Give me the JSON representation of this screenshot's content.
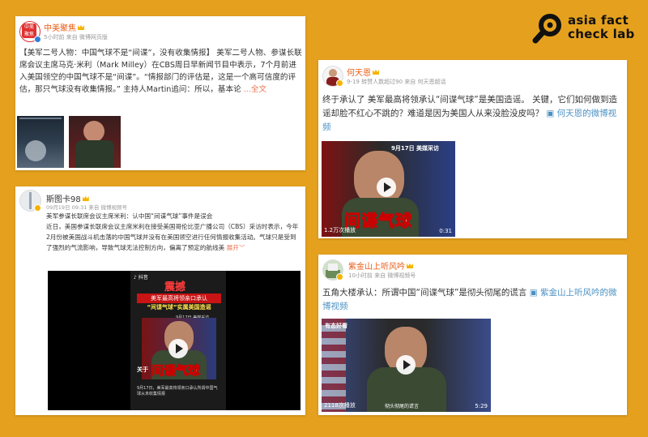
{
  "brand": {
    "line1": "asia fact",
    "line2": "check lab"
  },
  "posts": [
    {
      "username": "中美聚焦",
      "avatar_text": "聚中|焦美",
      "meta": "5小时前 来自 微博网页版",
      "text": "【美军二号人物：中国气球不是“间谍”，没有收集情报】 美军二号人物、参谋长联席会议主席马克·米利（Mark Milley）在CBS周日早新闻节目中表示，7个月前进入美国领空的中国气球不是“间谍”。“情报部门的评估是，这是一个高可信度的评估，那只气球没有收集情报。” 主持人Martin追问：所以，基本论",
      "more_label": "...全文"
    },
    {
      "username": "何天恩",
      "meta": "9-19 转赞人数超过90 来自 何天恩超话",
      "text": "终于承认了 美军最高将领承认“间谍气球”是美国造谣。 关键，它们如何做到造谣却脸不红心不跳的？难道是因为美国人从来没脸没皮吗？",
      "video_link": "何天恩的微博视频",
      "video": {
        "top_caption": "9月17日 美媒采访",
        "big_caption": "间谍气球",
        "views": "1.2万次播放",
        "duration": "0:31"
      }
    },
    {
      "username": "斯图卡98",
      "meta": "09月19日 09:31 来自 微博视频号",
      "text": "美军参谋长联席会议主席米利：认中国“间谍气球”事件是误会\n近日，美国参谋长联席会议主席米利在接受美国哥伦比亚广播公司（CBS）采访时表示，今年2月份被美国战斗机击落的中国气球并没有在美国领空进行任何情报收集活动。气球只是受到了强烈的气流影响，导致气球无法控制方向，偏离了预定的航线美",
      "expand_label": "展开",
      "video": {
        "app_name": "抖音",
        "headline": "震撼",
        "sub1": "美军最高将领亲口承认",
        "sub2": "“间谍气球”实属美国造谣",
        "date_tag": "9月17日 美媒采访",
        "side_text": "关于",
        "big_caption": "间谍气球",
        "bottom_text": "9月17日，美军最高将领亲口承认所谓中国气球从未收集情报"
      }
    },
    {
      "username": "紫金山上听风吟",
      "meta": "10小时前 来自 微博视频号",
      "text": "五角大楼承认：所谓中国“间谍气球”是彻头彻尾的谎言",
      "video_link": "紫金山上听风吟的微博视频",
      "video": {
        "watermark": "有态好看",
        "views": "2118次播放",
        "subtitle": "彻头彻尾的谎言",
        "duration": "5:29"
      }
    }
  ]
}
